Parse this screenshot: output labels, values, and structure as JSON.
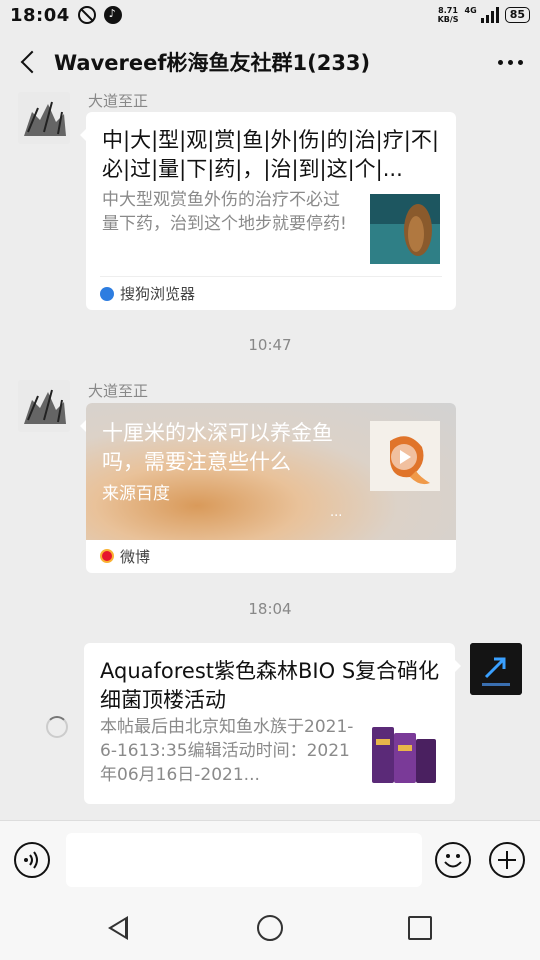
{
  "status_bar": {
    "time": "18:04",
    "net_speed": "8.71",
    "net_unit": "KB/S",
    "network": "4G",
    "battery": "85"
  },
  "header": {
    "title": "Wavereef彬海鱼友社群1(233)"
  },
  "messages": [
    {
      "sender": "大道至正",
      "title": "中|大|型|观|赏|鱼|外|伤|的|治|疗|不|必|过|量|下|药|，|治|到|这|个|...",
      "desc": "中大型观赏鱼外伤的治疗不必过量下药，治到这个地步就要停药!",
      "source": "搜狗浏览器"
    },
    {
      "sender": "大道至正",
      "title": "十厘米的水深可以养金鱼吗，需要注意些什么",
      "desc": "来源百度",
      "ellipsis": "...",
      "source": "微博"
    },
    {
      "title": "Aquaforest紫色森林BIO S复合硝化细菌顶楼活动",
      "desc": "本帖最后由北京知鱼水族于2021-6-1613:35编辑活动时间：2021年06月16日-2021..."
    }
  ],
  "times": [
    "10:47",
    "18:04"
  ],
  "input": {
    "placeholder": ""
  },
  "colors": {
    "background": "#ededed",
    "bubble": "#ffffff",
    "muted_text": "#888888"
  }
}
